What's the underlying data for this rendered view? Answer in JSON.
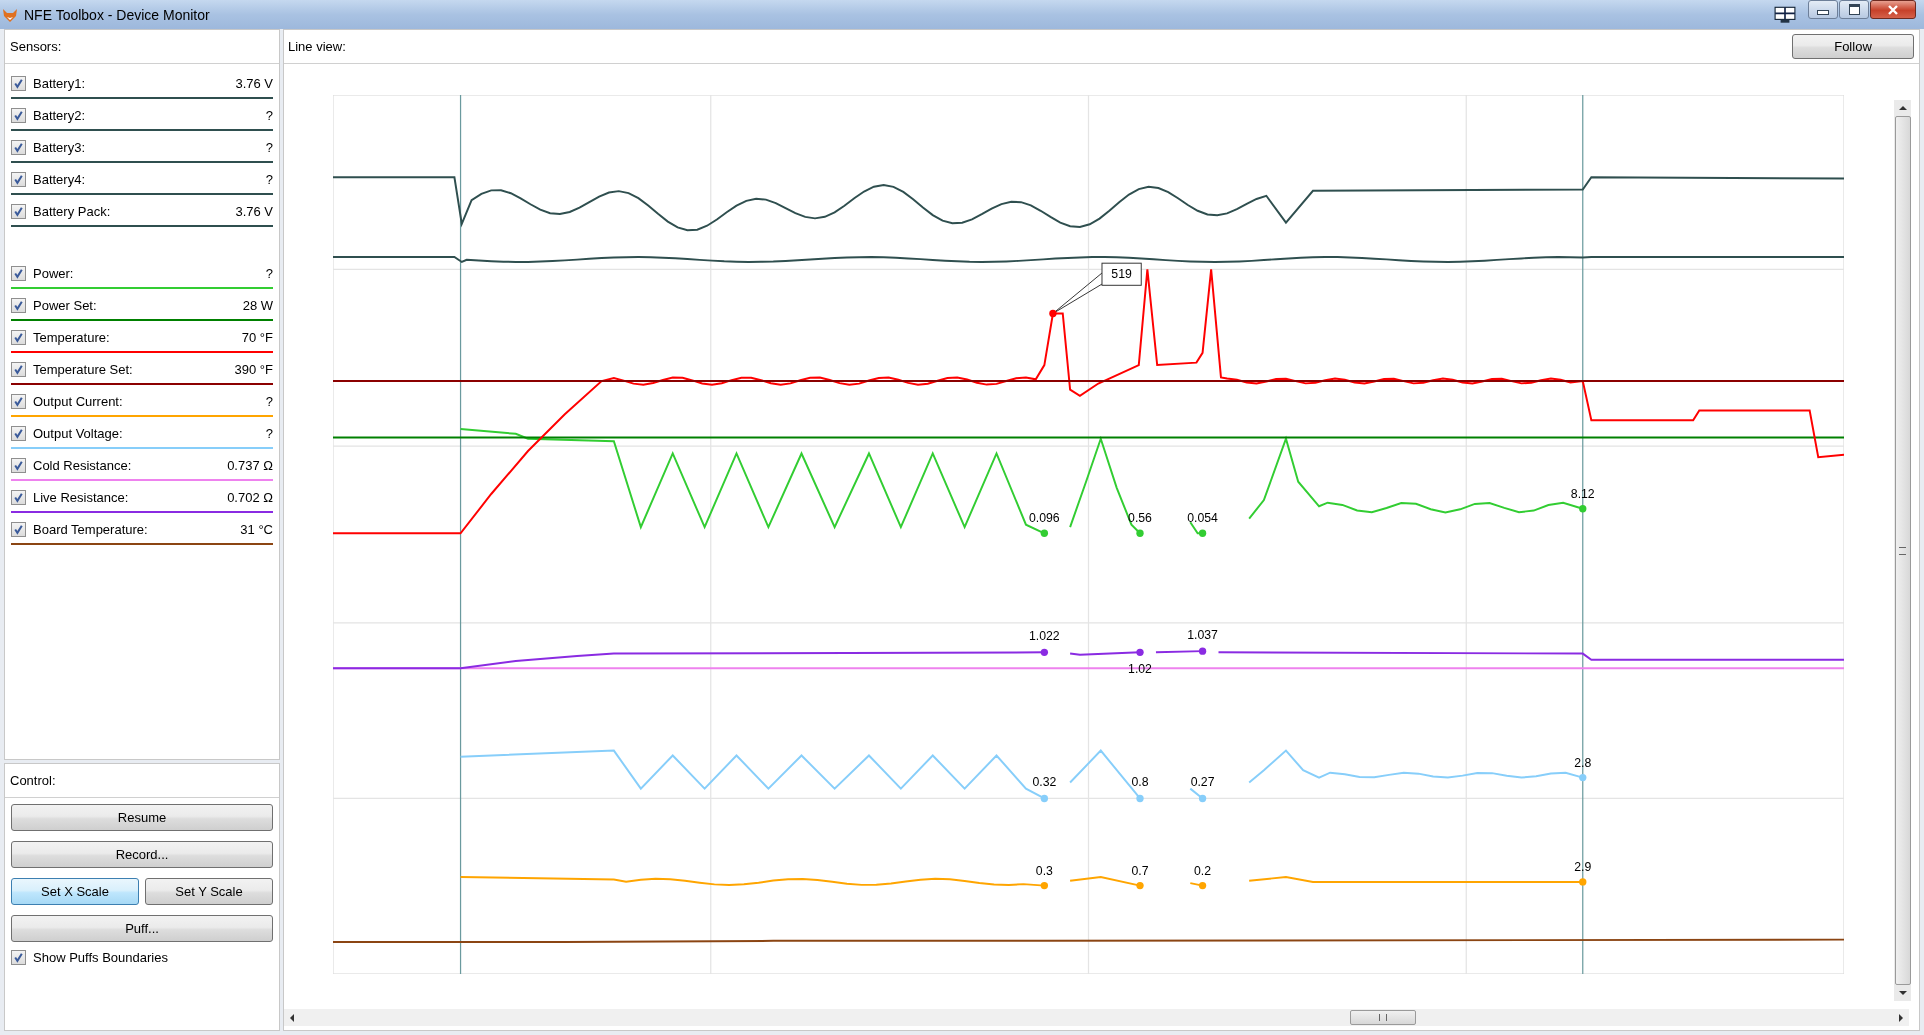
{
  "window": {
    "title": "NFE Toolbox - Device Monitor"
  },
  "sensors": {
    "title": "Sensors:",
    "groups": [
      {
        "items": [
          {
            "label": "Battery1:",
            "value": "3.76 V",
            "checked": true,
            "color": "#2f4f4f"
          },
          {
            "label": "Battery2:",
            "value": "?",
            "checked": true,
            "color": "#2f4f4f"
          },
          {
            "label": "Battery3:",
            "value": "?",
            "checked": true,
            "color": "#2f4f4f"
          },
          {
            "label": "Battery4:",
            "value": "?",
            "checked": true,
            "color": "#2f4f4f"
          },
          {
            "label": "Battery Pack:",
            "value": "3.76 V",
            "checked": true,
            "color": "#2f4f4f"
          }
        ]
      },
      {
        "items": [
          {
            "label": "Power:",
            "value": "?",
            "checked": true,
            "color": "#32cd32"
          },
          {
            "label": "Power Set:",
            "value": "28 W",
            "checked": true,
            "color": "#008000"
          },
          {
            "label": "Temperature:",
            "value": "70 °F",
            "checked": true,
            "color": "#ff0000"
          },
          {
            "label": "Temperature Set:",
            "value": "390 °F",
            "checked": true,
            "color": "#8b0000"
          },
          {
            "label": "Output Current:",
            "value": "?",
            "checked": true,
            "color": "#ffa500"
          },
          {
            "label": "Output Voltage:",
            "value": "?",
            "checked": true,
            "color": "#87cefa"
          },
          {
            "label": "Cold Resistance:",
            "value": "0.737 Ω",
            "checked": true,
            "color": "#ee82ee"
          },
          {
            "label": "Live Resistance:",
            "value": "0.702 Ω",
            "checked": true,
            "color": "#8a2be2"
          },
          {
            "label": "Board Temperature:",
            "value": "31 °C",
            "checked": true,
            "color": "#8b4513"
          }
        ]
      }
    ]
  },
  "control": {
    "title": "Control:",
    "button_rows": [
      [
        {
          "label": "Resume",
          "focused": false
        }
      ],
      [
        {
          "label": "Record...",
          "focused": false
        }
      ],
      [
        {
          "label": "Set X Scale",
          "focused": true
        },
        {
          "label": "Set Y Scale",
          "focused": false
        }
      ],
      [
        {
          "label": "Puff...",
          "focused": false
        }
      ]
    ],
    "show_puffs_boundaries": {
      "label": "Show Puffs Boundaries",
      "checked": true
    }
  },
  "line_view": {
    "title": "Line view:",
    "follow_button": "Follow",
    "value_labels": [
      {
        "text": "519",
        "kind": "callout"
      },
      {
        "text": "0.096",
        "kind": "plain"
      },
      {
        "text": "0.56",
        "kind": "plain"
      },
      {
        "text": "0.054",
        "kind": "plain"
      },
      {
        "text": "8.12",
        "kind": "plain"
      },
      {
        "text": "1.022",
        "kind": "plain"
      },
      {
        "text": "1.02",
        "kind": "plain"
      },
      {
        "text": "1.037",
        "kind": "plain"
      },
      {
        "text": "0.32",
        "kind": "plain"
      },
      {
        "text": "0.8",
        "kind": "plain"
      },
      {
        "text": "0.27",
        "kind": "plain"
      },
      {
        "text": "2.8",
        "kind": "plain"
      },
      {
        "text": "0.3",
        "kind": "plain"
      },
      {
        "text": "0.7",
        "kind": "plain"
      },
      {
        "text": "0.2",
        "kind": "plain"
      },
      {
        "text": "2.9",
        "kind": "plain"
      }
    ]
  }
}
